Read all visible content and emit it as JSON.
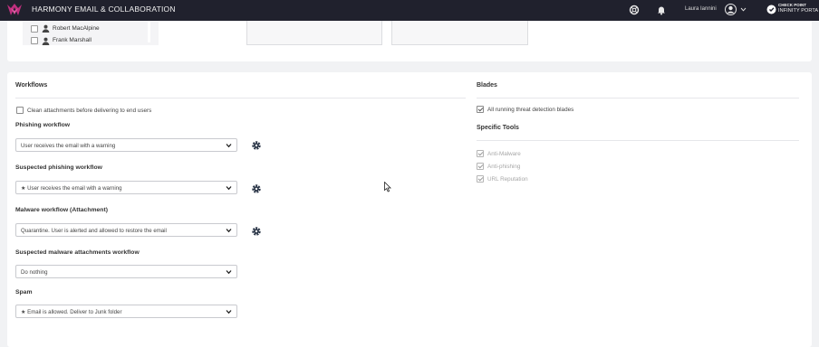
{
  "header": {
    "app_title": "HARMONY EMAIL & COLLABORATION",
    "user_name": "Laura Iannini",
    "brand_line1": "CHECK POINT",
    "brand_line2": "INFINITY PORTA",
    "icons": [
      "logo-icon",
      "help-icon",
      "bell-icon",
      "user-avatar-icon",
      "chevron-down-icon",
      "checkpoint-logo-icon"
    ]
  },
  "users_list": {
    "items": [
      {
        "name": "Robert MacAlpine"
      },
      {
        "name": "Frank Marshall"
      }
    ]
  },
  "workflows": {
    "title": "Workflows",
    "clean_attachments_label": "Clean attachments before delivering to end users",
    "phishing": {
      "label": "Phishing workflow",
      "value": "User receives the email with a warning"
    },
    "suspected_phishing": {
      "label": "Suspected phishing workflow",
      "value": "★ User receives the email with a warning"
    },
    "malware": {
      "label": "Malware workflow (Attachment)",
      "value": "Quarantine. User is alerted and allowed to restore the email"
    },
    "suspected_malware": {
      "label": "Suspected malware attachments workflow",
      "value": "Do nothing"
    },
    "spam": {
      "label": "Spam",
      "value": "★ Email is allowed. Deliver to Junk folder"
    }
  },
  "blades": {
    "title": "Blades",
    "all_running_label": "All running threat detection blades",
    "specific_tools_title": "Specific Tools",
    "tools": [
      {
        "label": "Anti-Malware",
        "checked": true
      },
      {
        "label": "Anti-phishing",
        "checked": true
      },
      {
        "label": "URL Reputation",
        "checked": true
      }
    ]
  },
  "colors": {
    "topbar_bg": "#20212d",
    "logo_accent": "#c02f7f",
    "page_bg": "#f1f2f4",
    "card_bg": "#ffffff"
  }
}
